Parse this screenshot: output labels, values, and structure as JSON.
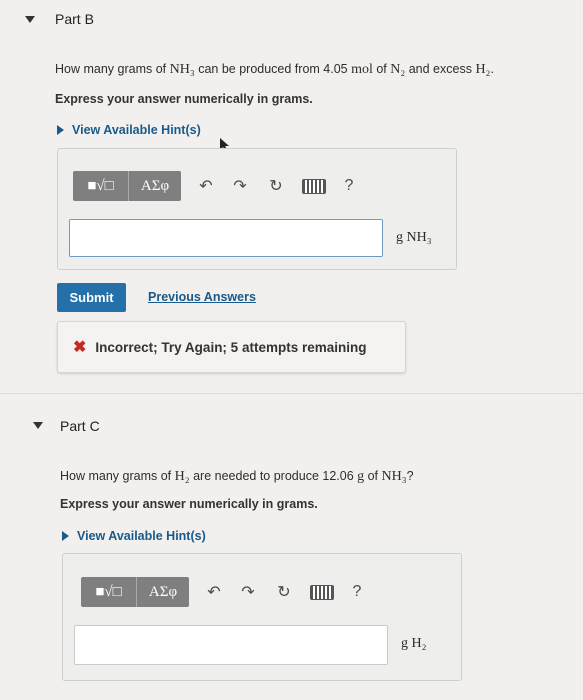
{
  "partB": {
    "title": "Part B",
    "question": {
      "t1": "How many grams of ",
      "m1": "NH₃",
      "t2": " can be produced from 4.05 ",
      "m2": "mol",
      "t3": " of ",
      "m3": "N₂",
      "t4": " and excess ",
      "m4": "H₂",
      "t5": "."
    },
    "instruction": "Express your answer numerically in grams.",
    "hint": "View Available Hint(s)",
    "toolbar": {
      "templates": "■√□",
      "symbols": "ΑΣφ",
      "help": "?"
    },
    "input_value": "",
    "units": "g NH₃",
    "submit": "Submit",
    "previous": "Previous Answers",
    "feedback": "Incorrect; Try Again; 5 attempts remaining"
  },
  "partC": {
    "title": "Part C",
    "question": {
      "t1": "How many grams of ",
      "m1": "H₂",
      "t2": " are needed to produce 12.06 ",
      "m2": "g",
      "t3": " of ",
      "m3": "NH₃",
      "t4": "?"
    },
    "instruction": "Express your answer numerically in grams.",
    "hint": "View Available Hint(s)",
    "toolbar": {
      "templates": "■√□",
      "symbols": "ΑΣφ",
      "help": "?"
    },
    "input_value": "",
    "units": "g H₂"
  },
  "colors": {
    "accent": "#2470a8",
    "error": "#c8281f",
    "link": "#1a5a8a",
    "background": "#f1f0ee"
  }
}
